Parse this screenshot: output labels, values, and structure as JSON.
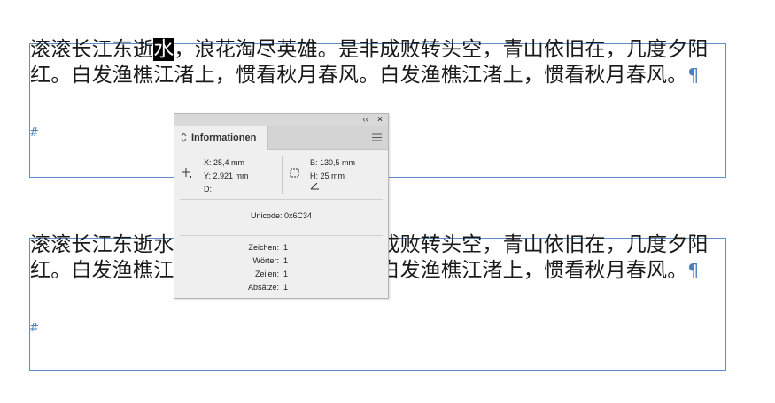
{
  "document": {
    "frame1": {
      "before_selection": "滚滚长江东逝",
      "selection": "水",
      "after_selection": "，浪花淘尽英雄。是非成败转头空，青山依旧在，几度夕阳红。白发渔樵江渚上，惯看秋月春风。白发渔樵江渚上，惯看秋月春风。",
      "pilcrow": "¶",
      "hash": "#"
    },
    "frame2": {
      "text": "滚滚长江东逝水，浪花淘尽英雄。是非成败转头空，青山依旧在，几度夕阳红。白发渔樵江渚上，惯看秋月春风。白发渔樵江渚上，惯看秋月春风。",
      "pilcrow": "¶",
      "hash": "#"
    }
  },
  "panel": {
    "collapse_glyph": "‹‹",
    "close_glyph": "×",
    "tab_icon": "⌃⌄",
    "tab_label": "Informationen",
    "menu_icon": "≡",
    "x_label": "X: 25,4 mm",
    "y_label": "Y: 2,921 mm",
    "d_label": "D:",
    "w_label": "B: 130,5 mm",
    "h_label": "H: 25 mm",
    "unicode_label": "Unicode: 0x6C34",
    "counts": [
      {
        "label": "Zeichen:",
        "value": "1"
      },
      {
        "label": "Wörter:",
        "value": "1"
      },
      {
        "label": "Zeilen:",
        "value": "1"
      },
      {
        "label": "Absätze:",
        "value": "1"
      }
    ]
  },
  "colors": {
    "frame_border": "#5b8fc9",
    "hidden_char": "#4a7fc0",
    "panel_bg": "#efefef"
  }
}
